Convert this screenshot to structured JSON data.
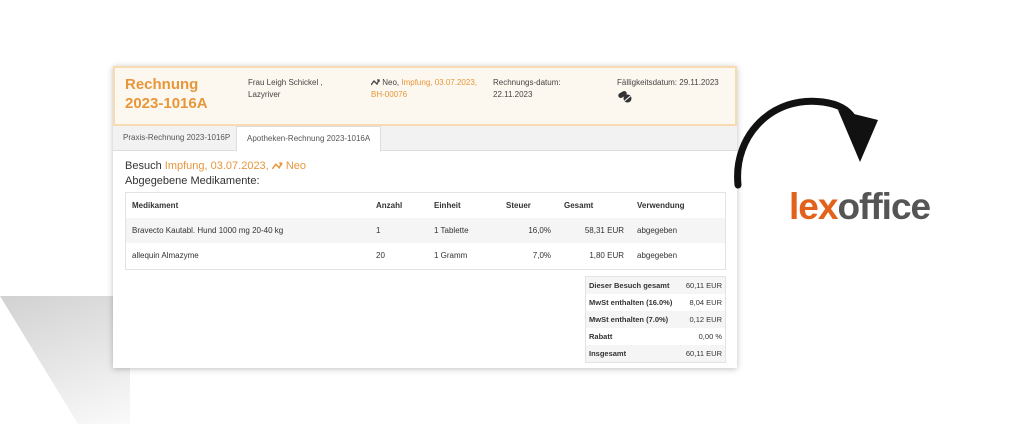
{
  "invoice": {
    "title": "Rechnung 2023-1016A",
    "customer": {
      "line1": "Frau Leigh Schickel ,",
      "line2": "Lazyriver"
    },
    "patient": {
      "prefix": "Neo,",
      "link1": "Impfung, 03.07.2023,",
      "link2": "BH-00076"
    },
    "invoice_date": {
      "label": "Rechnungs-datum:",
      "value": "22.11.2023"
    },
    "due_date": {
      "label": "Fälligkeitsdatum:",
      "value": "29.11.2023"
    }
  },
  "tabs": [
    {
      "label": "Praxis-Rechnung 2023-1016P",
      "active": false
    },
    {
      "label": "Apotheken-Rechnung 2023-1016A",
      "active": true
    }
  ],
  "visit": {
    "prefix": "Besuch",
    "link": "Impfung, 03.07.2023,",
    "patient": "Neo"
  },
  "meds_heading": "Abgegebene Medikamente:",
  "table": {
    "columns": [
      "Medikament",
      "Anzahl",
      "Einheit",
      "Steuer",
      "Gesamt",
      "Verwendung"
    ],
    "rows": [
      [
        "Bravecto Kautabl. Hund 1000 mg 20-40 kg",
        "1",
        "1 Tablette",
        "16,0%",
        "58,31 EUR",
        "abgegeben"
      ],
      [
        "allequin Almazyme",
        "20",
        "1 Gramm",
        "7,0%",
        "1,80 EUR",
        "abgegeben"
      ]
    ]
  },
  "totals": [
    {
      "label": "Dieser Besuch gesamt",
      "value": "60,11 EUR"
    },
    {
      "label": "MwSt enthalten (16.0%)",
      "value": "8,04 EUR"
    },
    {
      "label": "MwSt enthalten (7.0%)",
      "value": "0,12 EUR"
    },
    {
      "label": "Rabatt",
      "value": "0,00 %"
    },
    {
      "label": "Insgesamt",
      "value": "60,11 EUR"
    }
  ],
  "logo": {
    "part1": "lex",
    "part2": "office"
  },
  "colors": {
    "accent": "#e8963a",
    "logo_orange": "#e2621b",
    "logo_gray": "#555555"
  },
  "icons": {
    "pills": "pills-icon",
    "link": "link-arrow-icon"
  }
}
